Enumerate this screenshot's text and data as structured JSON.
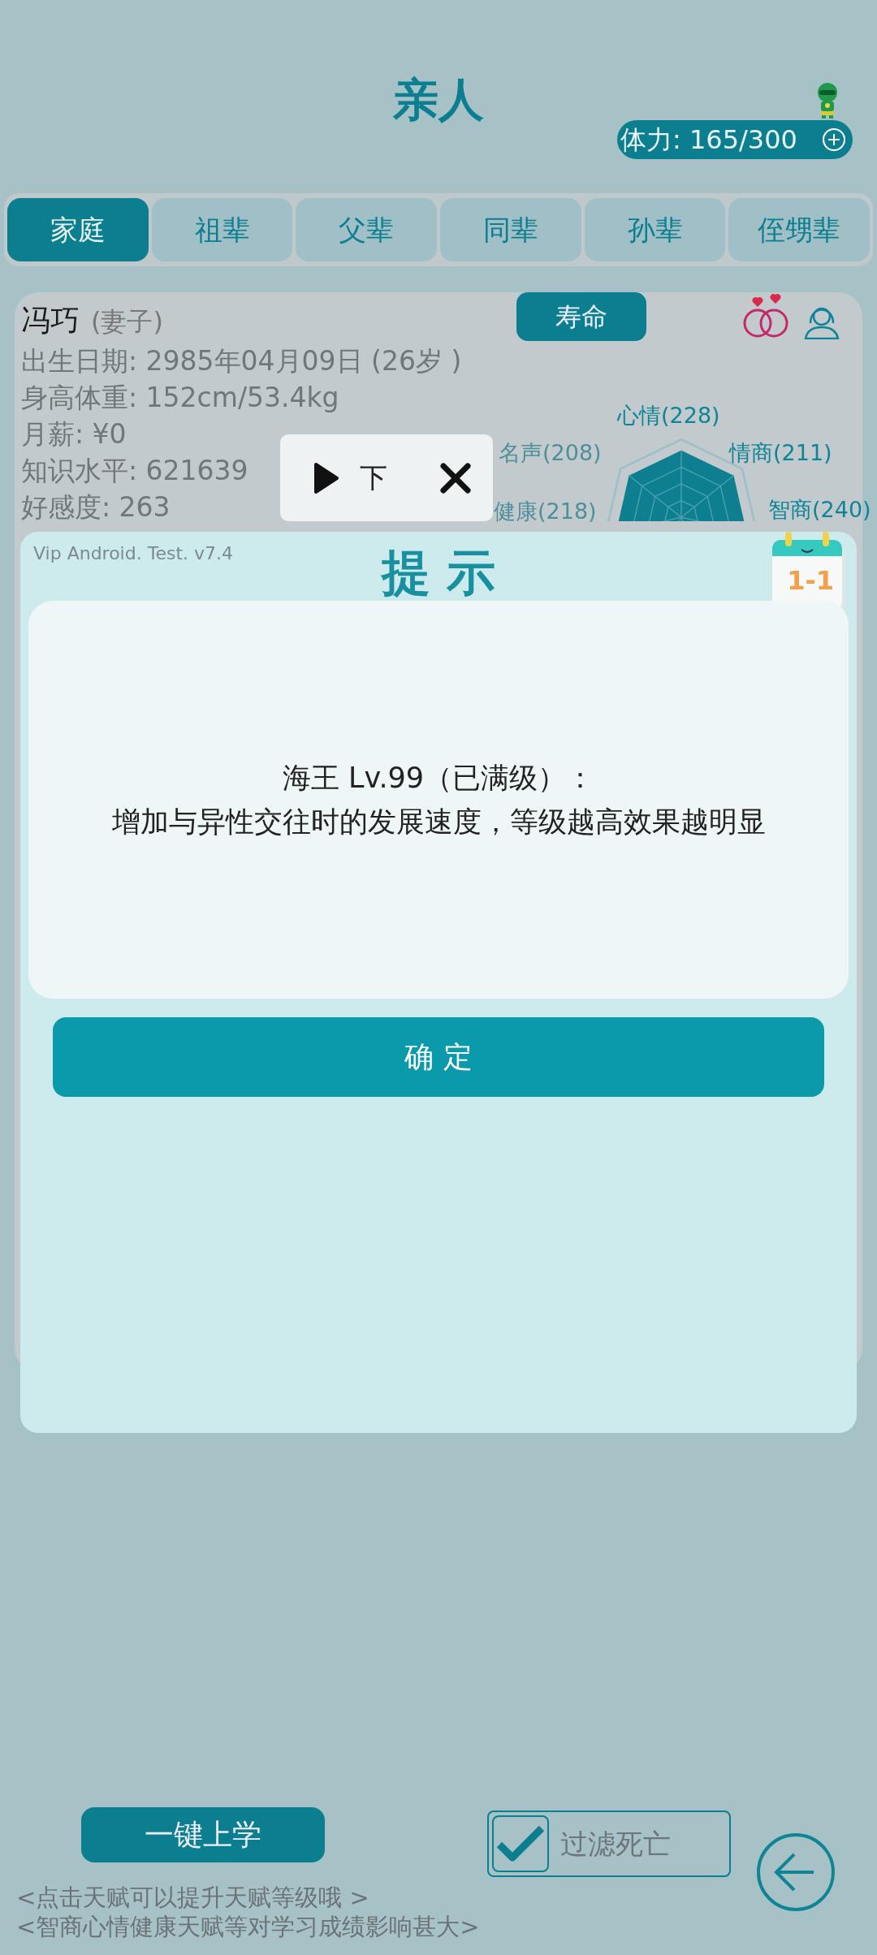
{
  "header": {
    "title": "亲人",
    "stamina": "体力: 165/300"
  },
  "tabs": [
    {
      "label": "家庭",
      "selected": true
    },
    {
      "label": "祖辈",
      "selected": false
    },
    {
      "label": "父辈",
      "selected": false
    },
    {
      "label": "同辈",
      "selected": false
    },
    {
      "label": "孙辈",
      "selected": false
    },
    {
      "label": "侄甥辈",
      "selected": false
    }
  ],
  "member": {
    "name": "冯巧",
    "relation": "(妻子)",
    "lifespan_button": "寿命",
    "details": [
      "出生日期: 2985年04月09日 (26岁 )",
      "身高体重: 152cm/53.4kg",
      "月薪: ¥0",
      "知识水平: 621639",
      "好感度: 263"
    ],
    "radar_labels": [
      "心情(228)",
      "情商(211)",
      "智商(240)",
      "健康(218)",
      "名声(208)"
    ]
  },
  "popup": {
    "text": "下"
  },
  "dialog": {
    "version": "Vip Android. Test. v7.4",
    "title": "提 示",
    "calendar": "1-1",
    "message": [
      "海王 Lv.99（已满级）：",
      "增加与异性交往时的发展速度，等级越高效果越明显"
    ],
    "confirm": "确 定"
  },
  "bottom": {
    "school_button": "一键上学",
    "filter": {
      "label": "过滤死亡",
      "checked": true
    },
    "hints": [
      "<点击天赋可以提升天赋等级哦 >",
      "<智商心情健康天赋等对学习成绩影响甚大>"
    ]
  }
}
